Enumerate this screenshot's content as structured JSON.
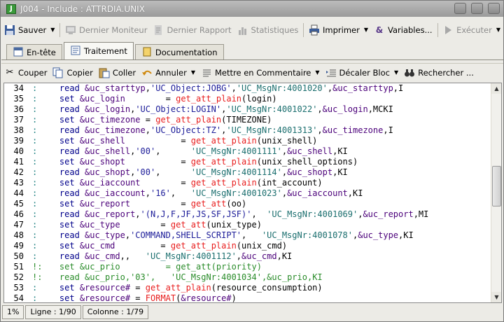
{
  "window": {
    "title": "J004 - Include : ATTRDIA.UNIX",
    "title_icon": "job-icon"
  },
  "toolbar_main": {
    "save": "Sauver",
    "last_monitor": "Dernier Moniteur",
    "last_report": "Dernier Rapport",
    "statistics": "Statistiques",
    "print": "Imprimer",
    "variables": "Variables...",
    "execute": "Exécuter"
  },
  "tabs": [
    {
      "label": "En-tête",
      "active": false
    },
    {
      "label": "Traitement",
      "active": true
    },
    {
      "label": "Documentation",
      "active": false
    }
  ],
  "toolbar_edit": {
    "cut": "Couper",
    "copy": "Copier",
    "paste": "Coller",
    "undo": "Annuler",
    "comment": "Mettre en Commentaire",
    "shift": "Décaler Bloc",
    "search": "Rechercher ..."
  },
  "code_lines": [
    {
      "n": "34",
      "m": ":",
      "t": "    read &uc_starttyp,'UC_Object:JOBG','UC_MsgNr:4001020',&uc_starttyp,I"
    },
    {
      "n": "35",
      "m": ":",
      "t": "    set &uc_login        = get_att_plain(login)"
    },
    {
      "n": "36",
      "m": ":",
      "t": "    read &uc_login,'UC_Object:LOGIN','UC_MsgNr:4001022',&uc_login,MCKI"
    },
    {
      "n": "37",
      "m": ":",
      "t": "    set &uc_timezone = get_att_plain(TIMEZONE)"
    },
    {
      "n": "38",
      "m": ":",
      "t": "    read &uc_timezone,'UC_Object:TZ','UC_MsgNr:4001313',&uc_timezone,I"
    },
    {
      "n": "39",
      "m": ":",
      "t": "    set &uc_shell           = get_att_plain(unix_shell)"
    },
    {
      "n": "40",
      "m": ":",
      "t": "    read &uc_shell,'00',      'UC_MsgNr:4001111',&uc_shell,KI"
    },
    {
      "n": "41",
      "m": ":",
      "t": "    set &uc_shopt           = get_att_plain(unix_shell_options)"
    },
    {
      "n": "42",
      "m": ":",
      "t": "    read &uc_shopt,'00',      'UC_MsgNr:4001114',&uc_shopt,KI"
    },
    {
      "n": "43",
      "m": ":",
      "t": "    set &uc_iaccount        = get_att_plain(int_account)"
    },
    {
      "n": "44",
      "m": ":",
      "t": "    read &uc_iaccount,'16',   'UC_MsgNr:4001023',&uc_iaccount,KI"
    },
    {
      "n": "45",
      "m": ":",
      "t": "    set &uc_report          = get_att(oo)"
    },
    {
      "n": "46",
      "m": ":",
      "t": "    read &uc_report,'(N,J,F,JF,JS,SF,JSF)',  'UC_MsgNr:4001069',&uc_report,MI"
    },
    {
      "n": "47",
      "m": ":",
      "t": "    set &uc_type        = get_att(unix_type)"
    },
    {
      "n": "48",
      "m": ":",
      "t": "    read &uc_type,'COMMAND,SHELL_SCRIPT',   'UC_MsgNr:4001078',&uc_type,KI"
    },
    {
      "n": "49",
      "m": ":",
      "t": "    set &uc_cmd         = get_att_plain(unix_cmd)"
    },
    {
      "n": "50",
      "m": ":",
      "t": "    read &uc_cmd,,   'UC_MsgNr:4001112',&uc_cmd,KI"
    },
    {
      "n": "51",
      "m": "!:",
      "t": "    set &uc_prio         = get_att(priority)"
    },
    {
      "n": "52",
      "m": "!:",
      "t": "    read &uc_prio,'03',   'UC_MsgNr:4001034',&uc_prio,KI"
    },
    {
      "n": "53",
      "m": ":",
      "t": "    set &resource# = get_att_plain(resource_consumption)"
    },
    {
      "n": "54",
      "m": ":",
      "t": "    set &resource# = FORMAT(&resource#)"
    }
  ],
  "status": {
    "zoom": "1%",
    "line": "Ligne : 1/90",
    "column": "Colonne : 1/79"
  }
}
